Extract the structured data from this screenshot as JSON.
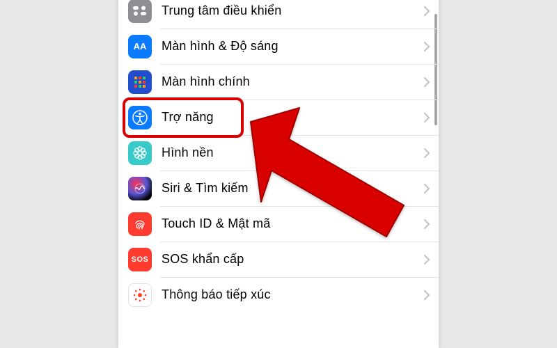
{
  "settings": {
    "items": [
      {
        "id": "control-center",
        "label": "Trung tâm điều khiển"
      },
      {
        "id": "display",
        "label": "Màn hình & Độ sáng"
      },
      {
        "id": "home-screen",
        "label": "Màn hình chính"
      },
      {
        "id": "accessibility",
        "label": "Trợ năng"
      },
      {
        "id": "wallpaper",
        "label": "Hình nền"
      },
      {
        "id": "siri",
        "label": "Siri & Tìm kiếm"
      },
      {
        "id": "touchid",
        "label": "Touch ID & Mật mã"
      },
      {
        "id": "sos",
        "label": "SOS khẩn cấp",
        "badge": "SOS"
      },
      {
        "id": "exposure",
        "label": "Thông báo tiếp xúc"
      }
    ]
  },
  "annotation": {
    "highlighted_item": "accessibility",
    "arrow_color": "#d90000"
  }
}
